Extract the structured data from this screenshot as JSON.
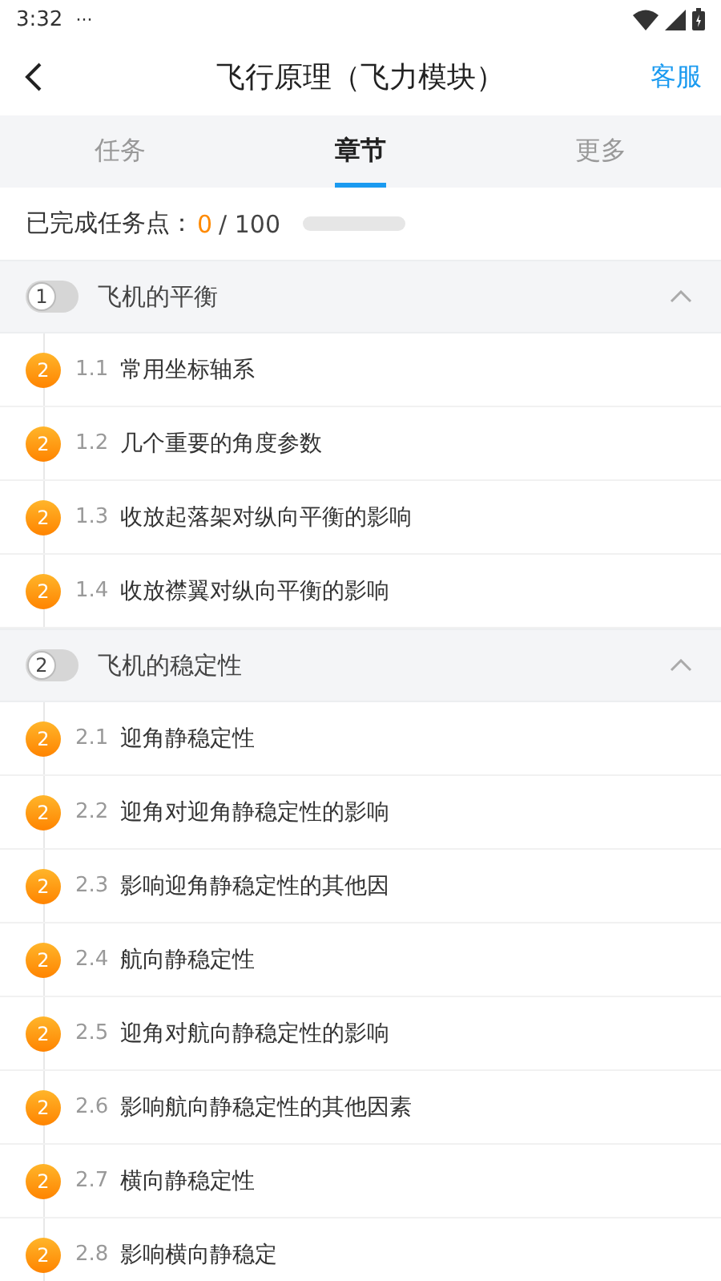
{
  "status_bar": {
    "time": "3:32",
    "more": "···"
  },
  "header": {
    "title": "飞行原理（飞力模块）",
    "action": "客服"
  },
  "tabs": [
    {
      "label": "任务",
      "selected": false
    },
    {
      "label": "章节",
      "selected": true
    },
    {
      "label": "更多",
      "selected": false
    }
  ],
  "progress": {
    "label": "已完成任务点：",
    "done": "0",
    "total": "/ 100",
    "level": 0
  },
  "chapters": [
    {
      "number": "1",
      "title": "飞机的平衡",
      "on": false,
      "expanded": true,
      "items": [
        {
          "badge": "2",
          "index": "1.1",
          "title": "常用坐标轴系"
        },
        {
          "badge": "2",
          "index": "1.2",
          "title": "几个重要的角度参数"
        },
        {
          "badge": "2",
          "index": "1.3",
          "title": "收放起落架对纵向平衡的影响"
        },
        {
          "badge": "2",
          "index": "1.4",
          "title": "收放襟翼对纵向平衡的影响"
        }
      ]
    },
    {
      "number": "2",
      "title": "飞机的稳定性",
      "on": false,
      "expanded": true,
      "items": [
        {
          "badge": "2",
          "index": "2.1",
          "title": "迎角静稳定性"
        },
        {
          "badge": "2",
          "index": "2.2",
          "title": "迎角对迎角静稳定性的影响"
        },
        {
          "badge": "2",
          "index": "2.3",
          "title": "影响迎角静稳定性的其他因"
        },
        {
          "badge": "2",
          "index": "2.4",
          "title": "航向静稳定性"
        },
        {
          "badge": "2",
          "index": "2.5",
          "title": "迎角对航向静稳定性的影响"
        },
        {
          "badge": "2",
          "index": "2.6",
          "title": "影响航向静稳定性的其他因素"
        },
        {
          "badge": "2",
          "index": "2.7",
          "title": "横向静稳定性"
        },
        {
          "badge": "2",
          "index": "2.8",
          "title": "影响横向静稳定"
        }
      ]
    }
  ]
}
